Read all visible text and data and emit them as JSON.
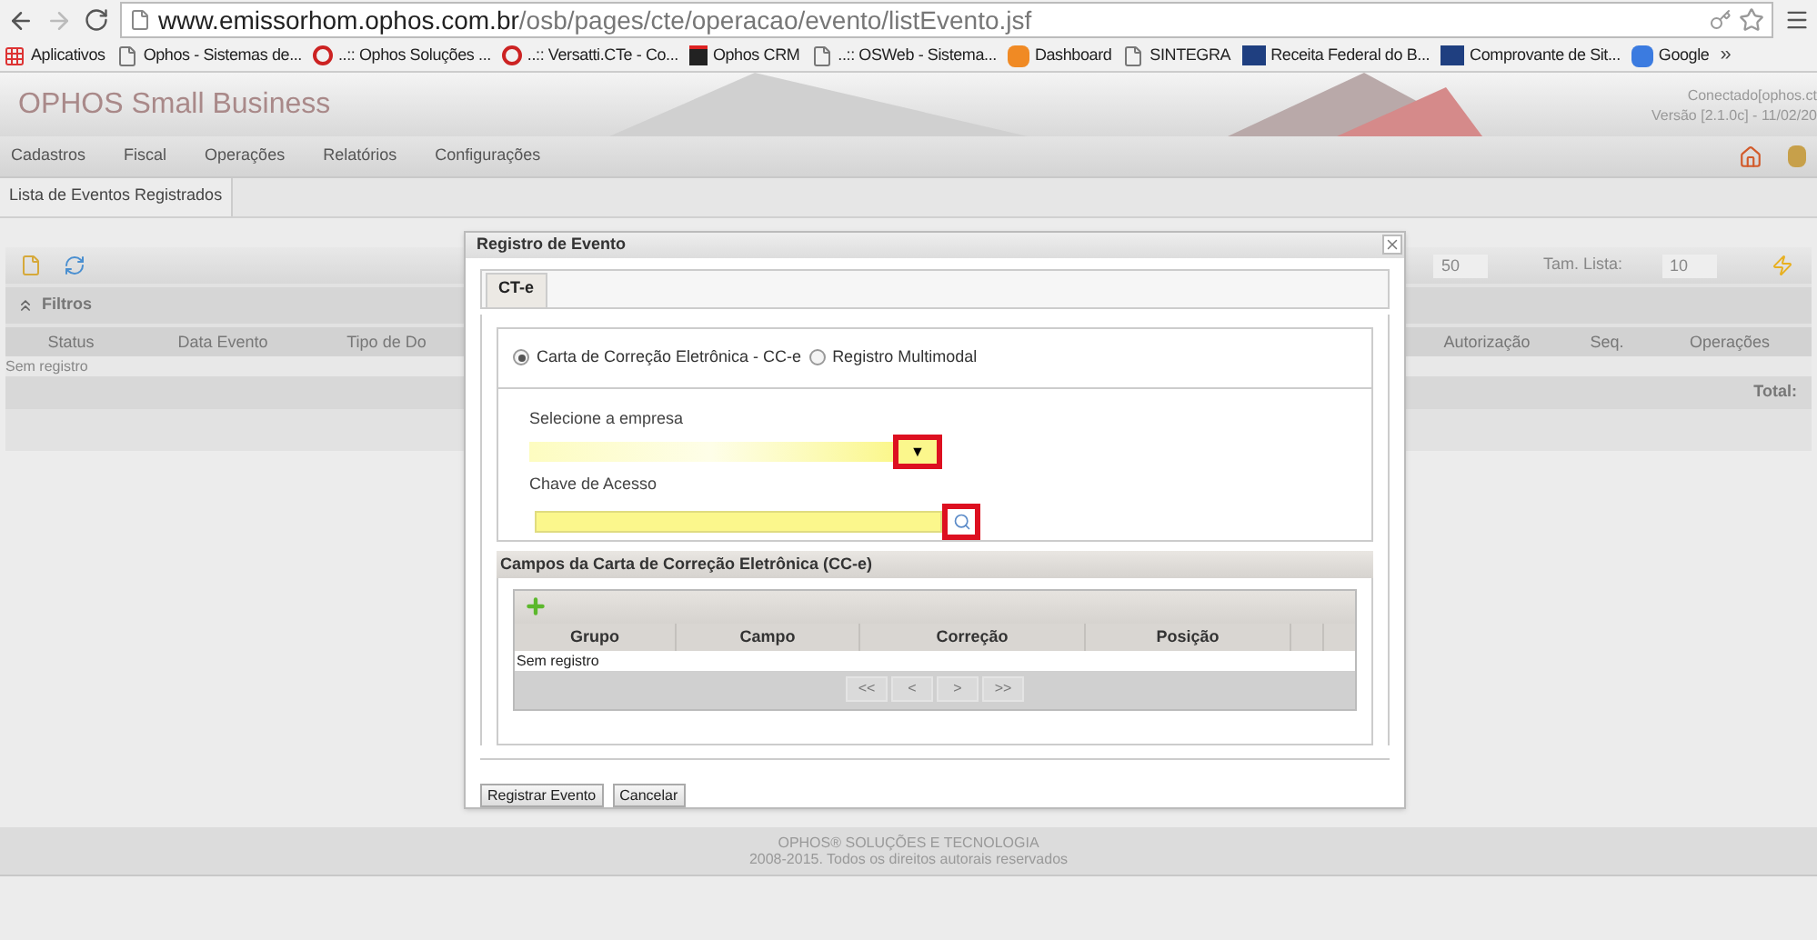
{
  "browser": {
    "url_host": "www.emissorhom.ophos.com.br",
    "url_path": "/osb/pages/cte/operacao/evento/listEvento.jsf",
    "bookmarks": [
      {
        "label": "Aplicativos",
        "kind": "apps"
      },
      {
        "label": "Ophos - Sistemas de...",
        "kind": "page"
      },
      {
        "label": "..:: Ophos Soluções ...",
        "kind": "ring"
      },
      {
        "label": "..:: Versatti.CTe - Co...",
        "kind": "ring"
      },
      {
        "label": "Ophos CRM",
        "kind": "crm"
      },
      {
        "label": "..:: OSWeb - Sistema...",
        "kind": "page"
      },
      {
        "label": "Dashboard",
        "kind": "orange"
      },
      {
        "label": "SINTEGRA",
        "kind": "page"
      },
      {
        "label": "Receita Federal do B...",
        "kind": "gov"
      },
      {
        "label": "Comprovante de Sit...",
        "kind": "gov"
      },
      {
        "label": "Google",
        "kind": "google"
      }
    ],
    "overflow": "»"
  },
  "header": {
    "logo": "OPHOS Small Business",
    "connection": "Conectado[ophos.ct",
    "version": "Versão [2.1.0c] - 11/02/20"
  },
  "menu": [
    "Cadastros",
    "Fiscal",
    "Operações",
    "Relatórios",
    "Configurações"
  ],
  "page_tab": {
    "label": "Lista de Eventos Registrados"
  },
  "toolbar": {
    "page_size_field": "50",
    "list_size_label": "Tam. Lista:",
    "list_size_field": "10"
  },
  "filters": {
    "label": "Filtros"
  },
  "table": {
    "columns_left": [
      "Status",
      "Data Evento",
      "Tipo de Do"
    ],
    "columns_right": [
      "Autorização",
      "Seq.",
      "Operações"
    ],
    "empty": "Sem registro",
    "total_label": "Total:"
  },
  "dialog": {
    "title": "Registro de Evento",
    "tabs": [
      {
        "label": "CT-e",
        "selected": true
      }
    ],
    "options": [
      {
        "label": "Carta de Correção Eletrônica - CC-e",
        "selected": true
      },
      {
        "label": "Registro Multimodal",
        "selected": false
      }
    ],
    "company_label": "Selecione a empresa",
    "company_button_highlighted": true,
    "company_button_glyph": "▼",
    "access_key_label": "Chave de Acesso",
    "search_button_highlighted": true,
    "section_title": "Campos da Carta de Correção Eletrônica (CC-e)",
    "grid": {
      "columns": [
        "Grupo",
        "Campo",
        "Correção",
        "Posição"
      ],
      "empty": "Sem registro",
      "pager": [
        {
          "label": "<<",
          "disabled": true
        },
        {
          "label": "<",
          "disabled": true
        },
        {
          "label": ">",
          "disabled": true
        },
        {
          "label": ">>",
          "disabled": true
        }
      ]
    },
    "buttons": [
      "Registrar Evento",
      "Cancelar"
    ]
  },
  "footer": {
    "lines": [
      "OPHOS® SOLUÇÕES E TECNOLOGIA",
      "2008-2015. Todos os direitos autorais reservados"
    ]
  }
}
